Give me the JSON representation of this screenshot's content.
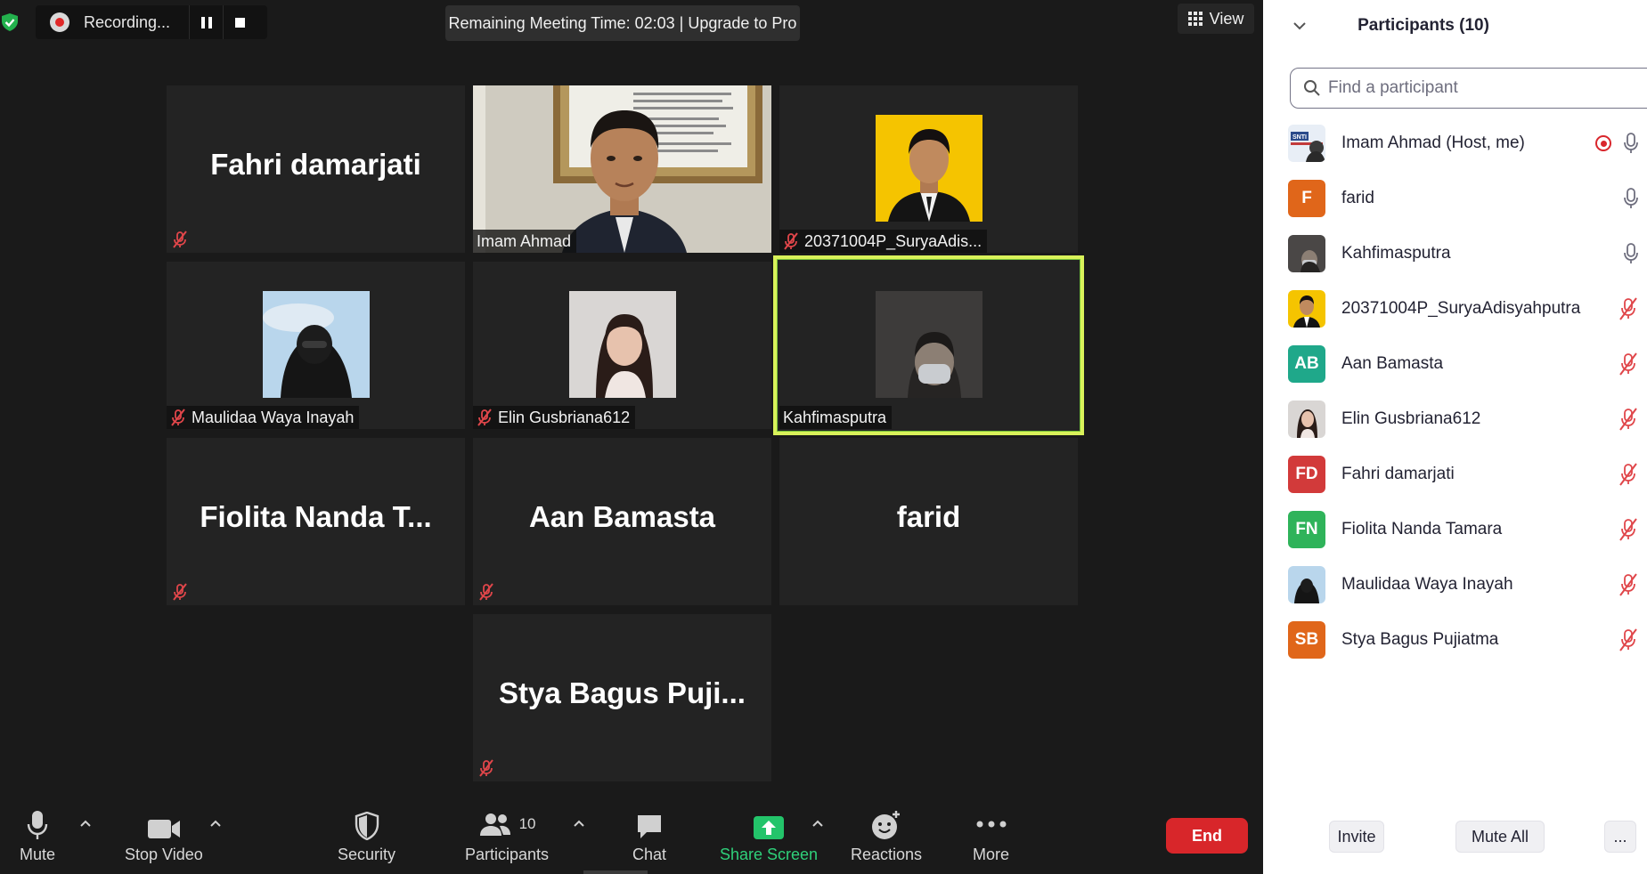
{
  "top_bar": {
    "recording_label": "Recording...",
    "meeting_timer": "Remaining Meeting Time: 02:03 | Upgrade to Pro",
    "view_label": "View"
  },
  "tiles": [
    {
      "name": "Fahri damarjati",
      "label": "",
      "muted": true,
      "video": "none"
    },
    {
      "name": "",
      "label": "Imam Ahmad",
      "muted": false,
      "video": "camera"
    },
    {
      "name": "",
      "label": "20371004P_SuryaAdis...",
      "muted": true,
      "video": "photo-yellow"
    },
    {
      "name": "",
      "label": "Maulidaa Waya Inayah",
      "muted": true,
      "video": "photo-sky"
    },
    {
      "name": "",
      "label": "Elin Gusbriana612",
      "muted": true,
      "video": "photo-girl"
    },
    {
      "name": "",
      "label": "Kahfimasputra",
      "muted": false,
      "video": "photo-dark",
      "active_speaker": true
    },
    {
      "name": "Fiolita Nanda T...",
      "label": "",
      "muted": true,
      "video": "none"
    },
    {
      "name": "Aan Bamasta",
      "label": "",
      "muted": true,
      "video": "none"
    },
    {
      "name": "farid",
      "label": "",
      "muted": false,
      "video": "none"
    },
    {
      "name": "Stya Bagus Puji...",
      "label": "",
      "muted": true,
      "video": "none"
    }
  ],
  "toolbar": {
    "mute_label": "Mute",
    "stop_video_label": "Stop Video",
    "security_label": "Security",
    "participants_label": "Participants",
    "participants_count": "10",
    "chat_label": "Chat",
    "share_screen_label": "Share Screen",
    "reactions_label": "Reactions",
    "more_label": "More",
    "end_label": "End"
  },
  "panel": {
    "title": "Participants (10)",
    "search_placeholder": "Find a participant",
    "participants": [
      {
        "name": "Imam Ahmad (Host, me)",
        "avatar": "photo-logo",
        "initials": "",
        "color": "#3a5a8a",
        "recording": true,
        "muted": false
      },
      {
        "name": "farid",
        "avatar": "initials",
        "initials": "F",
        "color": "#e0661a",
        "recording": false,
        "muted": false
      },
      {
        "name": "Kahfimasputra",
        "avatar": "photo-dark",
        "initials": "",
        "color": "#5a5a5a",
        "recording": false,
        "muted": false
      },
      {
        "name": "20371004P_SuryaAdisyahputra",
        "avatar": "photo-yellow",
        "initials": "",
        "color": "#f2c200",
        "recording": false,
        "muted": true
      },
      {
        "name": "Aan Bamasta",
        "avatar": "initials",
        "initials": "AB",
        "color": "#1fa88a",
        "recording": false,
        "muted": true
      },
      {
        "name": "Elin Gusbriana612",
        "avatar": "photo-girl",
        "initials": "",
        "color": "#d8d8d8",
        "recording": false,
        "muted": true
      },
      {
        "name": "Fahri damarjati",
        "avatar": "initials",
        "initials": "FD",
        "color": "#d23a3a",
        "recording": false,
        "muted": true
      },
      {
        "name": "Fiolita Nanda Tamara",
        "avatar": "initials",
        "initials": "FN",
        "color": "#2fb35a",
        "recording": false,
        "muted": true
      },
      {
        "name": "Maulidaa Waya Inayah",
        "avatar": "photo-sky",
        "initials": "",
        "color": "#b8d4ea",
        "recording": false,
        "muted": true
      },
      {
        "name": "Stya Bagus Pujiatma",
        "avatar": "initials",
        "initials": "SB",
        "color": "#e0661a",
        "recording": false,
        "muted": true
      }
    ],
    "invite_label": "Invite",
    "mute_all_label": "Mute All",
    "more_label": "..."
  },
  "colors": {
    "accent_green": "#2fd17a",
    "end_red": "#d8262a",
    "muted_red": "#e0464a",
    "active_speaker": "#d9f25a"
  }
}
